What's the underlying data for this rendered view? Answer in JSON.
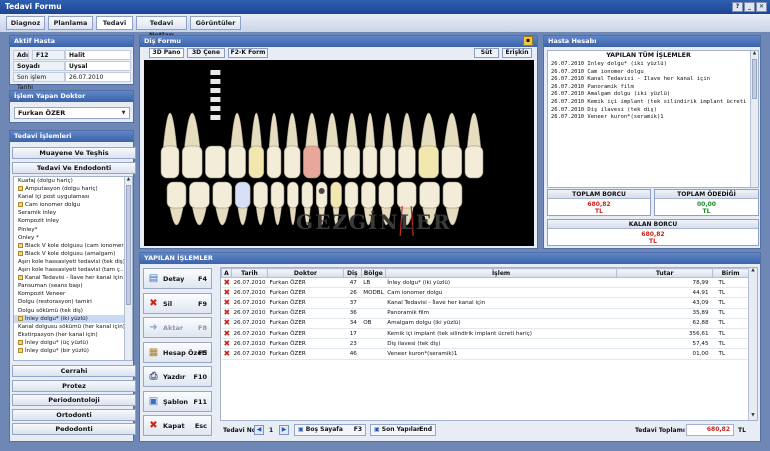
{
  "window": {
    "title": "Tedavi Formu",
    "controls": [
      "?",
      "_",
      "✕"
    ]
  },
  "menu": {
    "tabs": [
      "Diagnoz",
      "Planlama",
      "Tedavi",
      "Tedavi Notları",
      "Görüntüler"
    ]
  },
  "active_patient": {
    "header": "Aktif Hasta",
    "name_label": "Adı",
    "key_hint": "F12",
    "name_value": "Halit",
    "surname_label": "Soyadı",
    "surname_value": "Uysal",
    "last_treatment_label": "Son işlem Tarihi",
    "last_treatment_value": "26.07.2010"
  },
  "doctor": {
    "header": "İşlem Yapan Doktor",
    "selected": "Furkan ÖZER"
  },
  "treatments": {
    "header": "Tedavi İşlemleri",
    "group1": "Muayene Ve Teşhis",
    "group2": "Tedavi Ve Endodonti",
    "items": [
      "Kuafaj (dolgu hariç)",
      "Amputasyon (dolgu hariç)",
      "Kanal içi post uygulaması",
      "Cam ionomer dolgu",
      "Seramik inley",
      "Kompozit inley",
      "Pinley*",
      "Onley *",
      "Black V kole dolgusu (cam ionomer)",
      "Black V kole dolgusu (amalgam)",
      "Aşırı kole hassasiyeti tedavisi (tek diş)",
      "Aşırı kole hassasiyeti tedavisi (tam ç...",
      "Kanal Tedavisi - İlave her kanal için",
      "Pansuman (seans başı)",
      "Kompozit Veneer",
      "Dolgu (restorasyon) tamiri",
      "Dolgu sökümü (tek diş)",
      "İnley dolgu* (iki yüzlü)",
      "Kanal dolgusu sökümü (her kanal için)",
      "Ekstirpasyon (her kanal için)",
      "İnley dolgu* (üç yüzlü)",
      "İnley dolgu* (bir yüzlü)"
    ],
    "checked": [
      1,
      3,
      8,
      9,
      12,
      17,
      20,
      21
    ],
    "selected_index": 17,
    "bottom_groups": [
      "Cerrahi",
      "Protez",
      "Periodontoloji",
      "Ortodonti",
      "Pedodonti"
    ]
  },
  "chart": {
    "header": "Diş Formu",
    "tabs": [
      "3D Pano",
      "3D Çene",
      "F2-K Form"
    ],
    "right_tabs": [
      "Süt",
      "Erişkin"
    ],
    "watermark": "GEZGİNLER"
  },
  "account": {
    "header": "Hasta Hesabı",
    "list_title": "YAPILAN TÜM İŞLEMLER",
    "entries": [
      "26.07.2010 İnley dolgu* (iki yüzlü)",
      "26.07.2010 Cam ionomer dolgu",
      "26.07.2010 Kanal Tedavisi - İlave her kanal için",
      "26.07.2010 Panoramik film",
      "26.07.2010 Amalgam dolgu (iki yüzlü)",
      "26.07.2010 Kemik içi implant (tek silindirik implant ücreti hariç)",
      "26.07.2010 Diş ilavesi (tek diş)",
      "26.07.2010 Veneer kuron*(seramik)1"
    ],
    "total_debt_label": "TOPLAM BORCU",
    "total_debt_value": "680,82",
    "total_debt_unit": "TL",
    "total_paid_label": "TOPLAM ÖDEDİĞİ",
    "total_paid_value": "00,00",
    "total_paid_unit": "TL",
    "remaining_label": "KALAN BORCU",
    "remaining_value": "680,82",
    "remaining_unit": "TL",
    "debt_color": "#c8251b",
    "paid_color": "#1a8a2a"
  },
  "operations": {
    "header": "YAPILAN İŞLEMLER",
    "buttons": [
      {
        "label": "Detay",
        "key": "F4",
        "icon": "detail-icon"
      },
      {
        "label": "Sil",
        "key": "F9",
        "icon": "delete-icon"
      },
      {
        "label": "Aktar",
        "key": "F8",
        "icon": "transfer-icon"
      },
      {
        "label": "Hesap Özeti",
        "key": "F5",
        "icon": "summary-icon"
      },
      {
        "label": "Yazdır",
        "key": "F10",
        "icon": "print-icon"
      },
      {
        "label": "Şablon",
        "key": "F11",
        "icon": "template-icon"
      },
      {
        "label": "Kapat",
        "key": "Esc",
        "icon": "close-icon"
      }
    ],
    "columns": [
      "A",
      "Tarih",
      "Doktor",
      "Diş",
      "Bölge",
      "İşlem",
      "Tutar",
      "Birim"
    ],
    "rows": [
      {
        "date": "26.07.2010",
        "doctor": "Furkan ÖZER",
        "tooth": "47",
        "region": "LB",
        "proc": "İnley dolgu* (iki yüzlü)",
        "amount": "78,99",
        "unit": "TL"
      },
      {
        "date": "26.07.2010",
        "doctor": "Furkan ÖZER",
        "tooth": "26",
        "region": "MODBL",
        "proc": "Cam ionomer dolgu",
        "amount": "44,91",
        "unit": "TL"
      },
      {
        "date": "26.07.2010",
        "doctor": "Furkan ÖZER",
        "tooth": "37",
        "region": "",
        "proc": "Kanal Tedavisi - İlave her kanal için",
        "amount": "43,09",
        "unit": "TL"
      },
      {
        "date": "26.07.2010",
        "doctor": "Furkan ÖZER",
        "tooth": "36",
        "region": "",
        "proc": "Panoramik film",
        "amount": "35,89",
        "unit": "TL"
      },
      {
        "date": "26.07.2010",
        "doctor": "Furkan ÖZER",
        "tooth": "34",
        "region": "OB",
        "proc": "Amalgam dolgu (iki yüzlü)",
        "amount": "62,88",
        "unit": "TL"
      },
      {
        "date": "26.07.2010",
        "doctor": "Furkan ÖZER",
        "tooth": "17",
        "region": "",
        "proc": "Kemik içi implant (tek silindirik implant ücreti hariç)",
        "amount": "356,61",
        "unit": "TL"
      },
      {
        "date": "26.07.2010",
        "doctor": "Furkan ÖZER",
        "tooth": "23",
        "region": "",
        "proc": "Diş ilavesi (tek diş)",
        "amount": "57,45",
        "unit": "TL"
      },
      {
        "date": "26.07.2010",
        "doctor": "Furkan ÖZER",
        "tooth": "46",
        "region": "",
        "proc": "Veneer kuron*(seramik)1",
        "amount": "01,00",
        "unit": "TL"
      }
    ],
    "footer": {
      "label": "Tedavi No",
      "page": "1",
      "prev_page": "Boş Sayafa",
      "prev_key": "F3",
      "last_label": "Son Yapılan",
      "last_key": "End",
      "total_label": "Tedavi Toplamı",
      "total_value": "680,82",
      "total_unit": "TL"
    }
  }
}
